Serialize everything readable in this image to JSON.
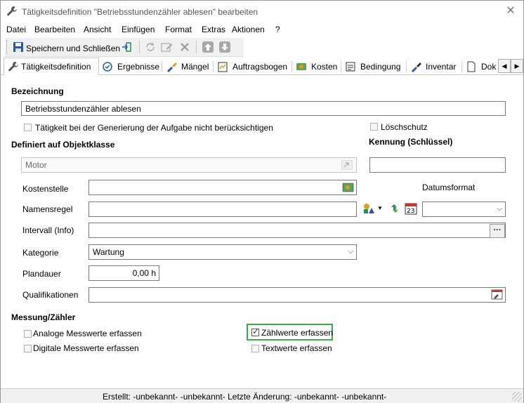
{
  "window": {
    "title": "Tätigkeitsdefinition \"Betriebsstundenzähler ablesen\" bearbeiten",
    "close_symbol": "✕"
  },
  "menu": {
    "items": [
      {
        "label": "Datei"
      },
      {
        "label": "Bearbeiten"
      },
      {
        "label": "Ansicht"
      },
      {
        "label": "Einfügen"
      },
      {
        "label": "Format"
      },
      {
        "label": "Extras"
      },
      {
        "label": "Aktionen"
      },
      {
        "label": "?"
      }
    ]
  },
  "toolbar": {
    "save_close_label": "Speichern und Schließen"
  },
  "tabs": [
    {
      "label": "Tätigkeitsdefinition",
      "icon": "wrench-icon"
    },
    {
      "label": "Ergebnisse",
      "icon": "results-icon"
    },
    {
      "label": "Mängel",
      "icon": "defects-icon"
    },
    {
      "label": "Auftragsbogen",
      "icon": "order-sheet-icon"
    },
    {
      "label": "Kosten",
      "icon": "costs-icon"
    },
    {
      "label": "Bedingung",
      "icon": "condition-icon"
    },
    {
      "label": "Inventar",
      "icon": "inventory-icon"
    },
    {
      "label": "Doku",
      "icon": "document-icon"
    }
  ],
  "form": {
    "bezeichnung_label": "Bezeichnung",
    "bezeichnung_value": "Betriebsstundenzähler ablesen",
    "ignore_task_label": "Tätigkeit bei der Generierung der Aufgabe nicht berücksichtigen",
    "loeschschutz_label": "Löschschutz",
    "objektklasse_label": "Definiert auf Objektklasse",
    "objektklasse_value": "Motor",
    "kennung_label": "Kennung (Schlüssel)",
    "kennung_value": "",
    "kostenstelle_label": "Kostenstelle",
    "kostenstelle_value": "",
    "datumsformat_label": "Datumsformat",
    "datumsformat_value": "",
    "namensregel_label": "Namensregel",
    "namensregel_value": "",
    "intervall_label": "Intervall (Info)",
    "intervall_value": "",
    "intervall_btn": "···",
    "kategorie_label": "Kategorie",
    "kategorie_value": "Wartung",
    "plandauer_label": "Plandauer",
    "plandauer_value": "0,00 h",
    "qualifikationen_label": "Qualifikationen",
    "qualifikationen_value": "",
    "messung_label": "Messung/Zähler",
    "analog_label": "Analoge Messwerte erfassen",
    "digital_label": "Digitale Messwerte erfassen",
    "zaehlwerte_label": "Zählwerte erfassen",
    "textwerte_label": "Textwerte erfassen",
    "zaehlwerte_checked": true
  },
  "status": {
    "text": "Erstellt: -unbekannt- -unbekannt-  Letzte Änderung: -unbekannt- -unbekannt-"
  },
  "colors": {
    "highlight": "#3bab4a"
  }
}
